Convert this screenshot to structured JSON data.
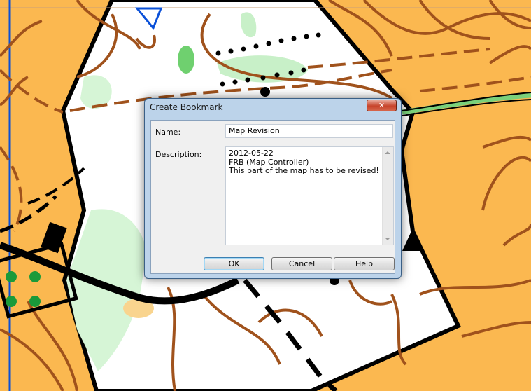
{
  "dialog": {
    "title": "Create Bookmark",
    "close_label": "✕",
    "name_label": "Name:",
    "name_value": "Map Revision",
    "description_label": "Description:",
    "description_lines": [
      "2012-05-22",
      "FRB (Map Controller)",
      "This part of the map has to be revised!"
    ],
    "buttons": {
      "ok": "OK",
      "cancel": "Cancel",
      "help": "Help"
    }
  },
  "colors": {
    "open_land": "#fbb850",
    "forest": "#ffffff",
    "green": "#cdf3cd",
    "contour": "#a0521c",
    "blue_line": "#0a50d8"
  }
}
